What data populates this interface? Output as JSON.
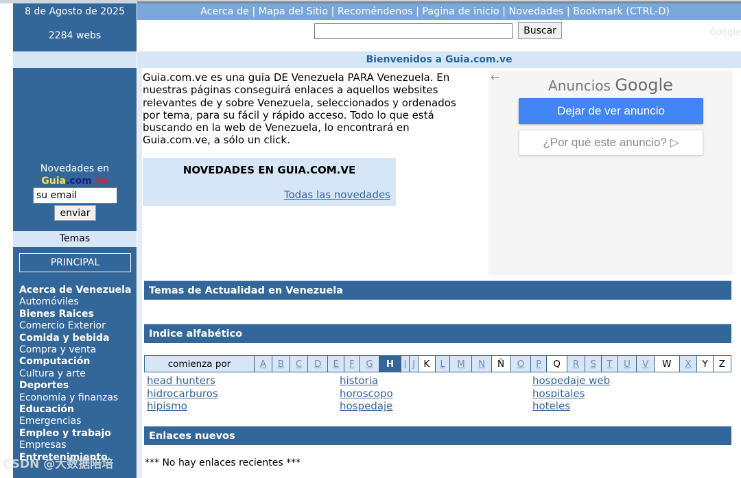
{
  "left": {
    "date": "8 de Agosto de 2025",
    "count": "2284 webs",
    "newsletter_label": "Novedades en",
    "brand": [
      "Guia",
      ".com",
      ".ve"
    ],
    "email_value": "su email",
    "send_label": "enviar",
    "temas_label": "Temas",
    "principal_label": "PRINCIPAL",
    "categories": [
      {
        "label": "Acerca de Venezuela",
        "bold": true
      },
      {
        "label": "Automóviles",
        "bold": false
      },
      {
        "label": "Bienes Raices",
        "bold": true
      },
      {
        "label": "Comercio Exterior",
        "bold": false
      },
      {
        "label": "Comida y bebida",
        "bold": true
      },
      {
        "label": "Compra y venta",
        "bold": false
      },
      {
        "label": "Computación",
        "bold": true
      },
      {
        "label": "Cultura y arte",
        "bold": false
      },
      {
        "label": "Deportes",
        "bold": true
      },
      {
        "label": "Economía y finanzas",
        "bold": false
      },
      {
        "label": "Educación",
        "bold": true
      },
      {
        "label": "Emergencias",
        "bold": false
      },
      {
        "label": "Empleo y trabajo",
        "bold": true
      },
      {
        "label": "Empresas",
        "bold": false
      },
      {
        "label": "Entretenimiento",
        "bold": true
      }
    ]
  },
  "nav": {
    "items": [
      "Acerca de",
      "Mapa del Sitio",
      "Recoméndenos",
      "Pagina de inicio",
      "Novedades",
      "Bookmark (CTRL-D)"
    ],
    "separator": " | "
  },
  "search": {
    "button_label": "Buscar",
    "value": "",
    "ghost_text": "Google"
  },
  "welcome": "Bienvenidos a Guia.com.ve",
  "intro": "Guia.com.ve es una guia DE Venezuela PARA Venezuela. En nuestras páginas conseguirá enlaces a aquellos websites relevantes de y sobre Venezuela, seleccionados y ordenados por tema, para su fácil y rápido acceso. Todo lo que está buscando en la web de Venezuela, lo encontrará en Guia.com.ve, a sólo un click.",
  "novedades": {
    "heading": "NOVEDADES EN GUIA.COM.VE",
    "link": "Todas las novedades"
  },
  "ad": {
    "back_icon": "←",
    "title_prefix": "Anuncios",
    "title_brand": "Google",
    "stop_label": "Dejar de ver anuncio",
    "why_label": "¿Por qué este anuncio? ▷"
  },
  "sections": {
    "actualidad": "Temas de Actualidad en Venezuela",
    "indice": "Indice alfabético",
    "enlaces": "Enlaces nuevos"
  },
  "alphabet": {
    "label": "comienza por",
    "active": "H",
    "letters": [
      {
        "ch": "A",
        "link": true
      },
      {
        "ch": "B",
        "link": true
      },
      {
        "ch": "C",
        "link": true
      },
      {
        "ch": "D",
        "link": true
      },
      {
        "ch": "E",
        "link": true
      },
      {
        "ch": "F",
        "link": true
      },
      {
        "ch": "G",
        "link": true
      },
      {
        "ch": "H",
        "link": false
      },
      {
        "ch": "I",
        "link": true
      },
      {
        "ch": "J",
        "link": true
      },
      {
        "ch": "K",
        "link": false
      },
      {
        "ch": "L",
        "link": true
      },
      {
        "ch": "M",
        "link": true
      },
      {
        "ch": "N",
        "link": true
      },
      {
        "ch": "Ñ",
        "link": false
      },
      {
        "ch": "O",
        "link": true
      },
      {
        "ch": "P",
        "link": true
      },
      {
        "ch": "Q",
        "link": false
      },
      {
        "ch": "R",
        "link": true
      },
      {
        "ch": "S",
        "link": true
      },
      {
        "ch": "T",
        "link": true
      },
      {
        "ch": "U",
        "link": true
      },
      {
        "ch": "V",
        "link": true
      },
      {
        "ch": "W",
        "link": false
      },
      {
        "ch": "X",
        "link": true
      },
      {
        "ch": "Y",
        "link": false
      },
      {
        "ch": "Z",
        "link": false
      }
    ]
  },
  "terms": [
    [
      "head hunters",
      "hidrocarburos",
      "hipismo"
    ],
    [
      "historia",
      "horoscopo",
      "hospedaje"
    ],
    [
      "hospedaje web",
      "hospitales",
      "hoteles"
    ]
  ],
  "no_recent": "*** No hay enlaces recientes ***",
  "watermark": "CSDN @大数据陪培"
}
